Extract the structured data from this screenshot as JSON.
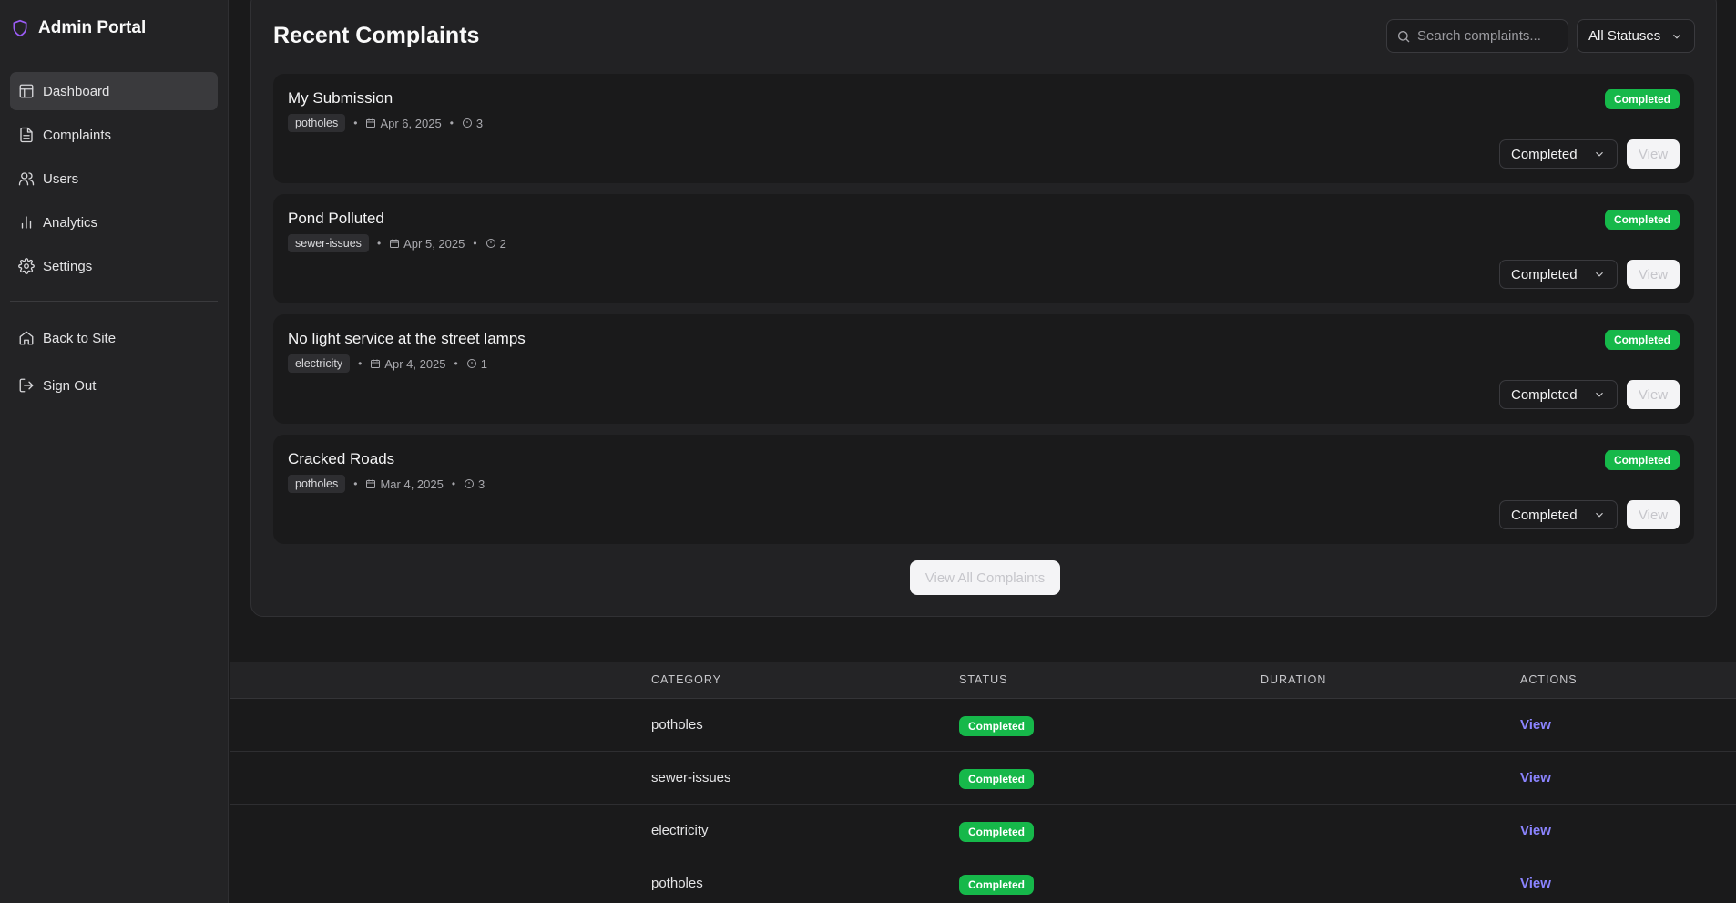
{
  "sidebar": {
    "brand": "Admin Portal",
    "items": [
      {
        "label": "Dashboard",
        "icon": "layout-icon",
        "active": true
      },
      {
        "label": "Complaints",
        "icon": "file-text-icon"
      },
      {
        "label": "Users",
        "icon": "users-icon"
      },
      {
        "label": "Analytics",
        "icon": "bar-chart-icon"
      },
      {
        "label": "Settings",
        "icon": "gear-icon"
      }
    ],
    "footer": [
      {
        "label": "Back to Site",
        "icon": "home-icon"
      },
      {
        "label": "Sign Out",
        "icon": "log-out-icon"
      }
    ]
  },
  "recent": {
    "title": "Recent Complaints",
    "search_placeholder": "Search complaints...",
    "status_filter": "All Statuses",
    "view_all": "View All Complaints",
    "items": [
      {
        "title": "My Submission",
        "tag": "potholes",
        "date": "Apr 6, 2025",
        "count": "3",
        "badge": "Completed",
        "status": "Completed",
        "view": "View"
      },
      {
        "title": "Pond Polluted",
        "tag": "sewer-issues",
        "date": "Apr 5, 2025",
        "count": "2",
        "badge": "Completed",
        "status": "Completed",
        "view": "View"
      },
      {
        "title": "No light service at the street lamps",
        "tag": "electricity",
        "date": "Apr 4, 2025",
        "count": "1",
        "badge": "Completed",
        "status": "Completed",
        "view": "View"
      },
      {
        "title": "Cracked Roads",
        "tag": "potholes",
        "date": "Mar 4, 2025",
        "count": "3",
        "badge": "Completed",
        "status": "Completed",
        "view": "View"
      }
    ]
  },
  "table": {
    "headers": {
      "category": "CATEGORY",
      "status": "STATUS",
      "duration": "DURATION",
      "actions": "ACTIONS"
    },
    "rows": [
      {
        "category": "potholes",
        "status": "Completed",
        "action": "View"
      },
      {
        "category": "sewer-issues",
        "status": "Completed",
        "action": "View"
      },
      {
        "category": "electricity",
        "status": "Completed",
        "action": "View"
      },
      {
        "category": "potholes",
        "status": "Completed",
        "action": "View"
      }
    ]
  },
  "colors": {
    "accent": "#8b84ff",
    "success": "#16b84a",
    "shield": "#9b5cf6"
  }
}
